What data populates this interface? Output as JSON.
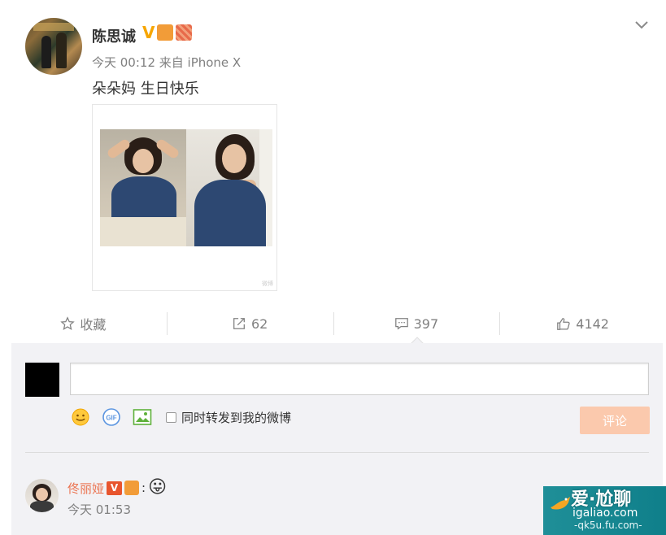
{
  "post": {
    "author": "陈思诚",
    "verified_mark": "V",
    "meta": "今天 00:12 来自 iPhone X",
    "text": "朵朵妈 生日快乐",
    "image_watermark": "微博"
  },
  "actions": {
    "favorite": "收藏",
    "repost": "62",
    "comment": "397",
    "like": "4142"
  },
  "composer": {
    "input_value": "",
    "sync_label": "同时转发到我的微博",
    "submit_label": "评论"
  },
  "comments": [
    {
      "name": "佟丽娅",
      "verified_mark": "V",
      "colon": ":",
      "emoji": "😛",
      "time": "今天 01:53"
    }
  ],
  "watermark": {
    "line1": "爱·尬聊",
    "line2": "igaliao.com",
    "line3": "-qk5u.fu.com-"
  },
  "colors": {
    "accent": "#eb7350",
    "submit_bg": "#fbc9ad",
    "verified": "#f7a600"
  }
}
